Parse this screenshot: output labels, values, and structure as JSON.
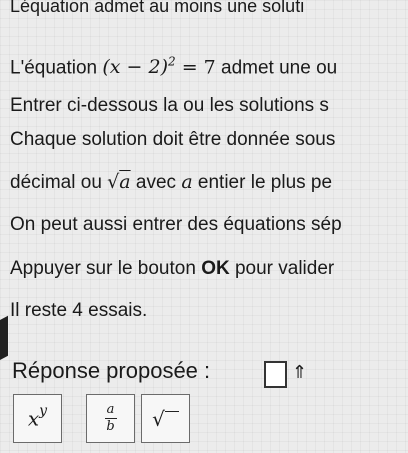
{
  "title": "Léquation admet au moins une soluti",
  "eq_line": {
    "prefix": "L'équation ",
    "equation": "(x − 2)",
    "exponent": "2",
    "rhs": " = 7",
    "suffix": " admet une ou"
  },
  "enter_line": "Entrer ci-dessous la ou les solutions s",
  "each_line1": "Chaque solution doit être donnée sous",
  "each_line2": {
    "before": "décimal ou ",
    "sqrt_var": "a",
    "middle": " avec ",
    "var": "a",
    "after": " entier le plus pe"
  },
  "also_line": "On peut aussi entrer des équations sép",
  "press_line": {
    "before": "Appuyer sur le bouton ",
    "ok": "OK",
    "after": " pour valider"
  },
  "remain_line": "Il reste 4 essais.",
  "answer_label": "Réponse proposée :",
  "toggle_icon": "up-arrow",
  "buttons": {
    "power": {
      "base": "x",
      "exp": "y"
    },
    "frac": {
      "num": "a",
      "den": "b"
    },
    "sqrt": "√"
  }
}
